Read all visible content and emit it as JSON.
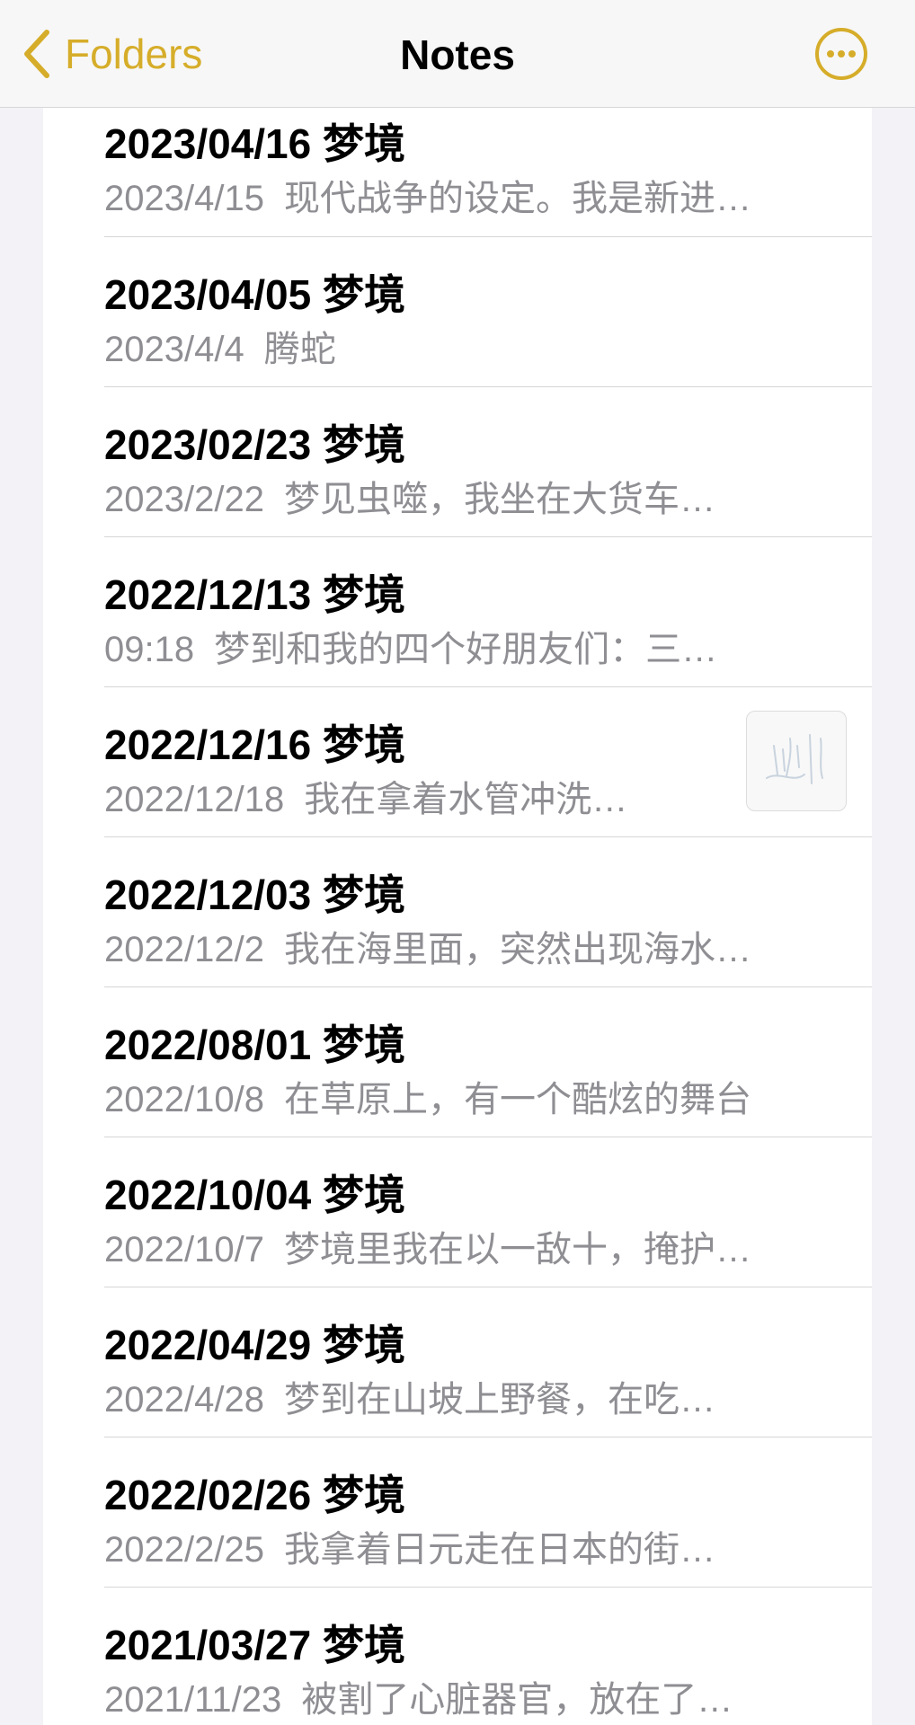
{
  "accent": "#d6ad2a",
  "navbar": {
    "back_label": "Folders",
    "title": "Notes",
    "back_icon": "chevron-left-icon",
    "more_icon": "ellipsis-circle-icon"
  },
  "notes": [
    {
      "title": "2023/04/16 梦境",
      "date": "2023/4/15",
      "preview": "现代战争的设定。我是新进…"
    },
    {
      "title": "2023/04/05 梦境",
      "date": "2023/4/4",
      "preview": "腾蛇"
    },
    {
      "title": "2023/02/23 梦境",
      "date": "2023/2/22",
      "preview": "梦见虫噬，我坐在大货车…"
    },
    {
      "title": "2022/12/13 梦境",
      "date": "09:18",
      "preview": "梦到和我的四个好朋友们：三…"
    },
    {
      "title": "2022/12/16 梦境",
      "date": "2022/12/18",
      "preview": "我在拿着水管冲洗…",
      "has_thumbnail": true
    },
    {
      "title": "2022/12/03 梦境",
      "date": "2022/12/2",
      "preview": "我在海里面，突然出现海水…"
    },
    {
      "title": "2022/08/01 梦境",
      "date": "2022/10/8",
      "preview": "在草原上，有一个酷炫的舞台"
    },
    {
      "title": "2022/10/04 梦境",
      "date": "2022/10/7",
      "preview": "梦境里我在以一敌十，掩护…"
    },
    {
      "title": "2022/04/29 梦境",
      "date": "2022/4/28",
      "preview": "梦到在山坡上野餐，在吃…"
    },
    {
      "title": "2022/02/26 梦境",
      "date": "2022/2/25",
      "preview": "我拿着日元走在日本的街…"
    },
    {
      "title": "2021/03/27 梦境",
      "date": "2021/11/23",
      "preview": "被割了心脏器官，放在了…"
    }
  ]
}
